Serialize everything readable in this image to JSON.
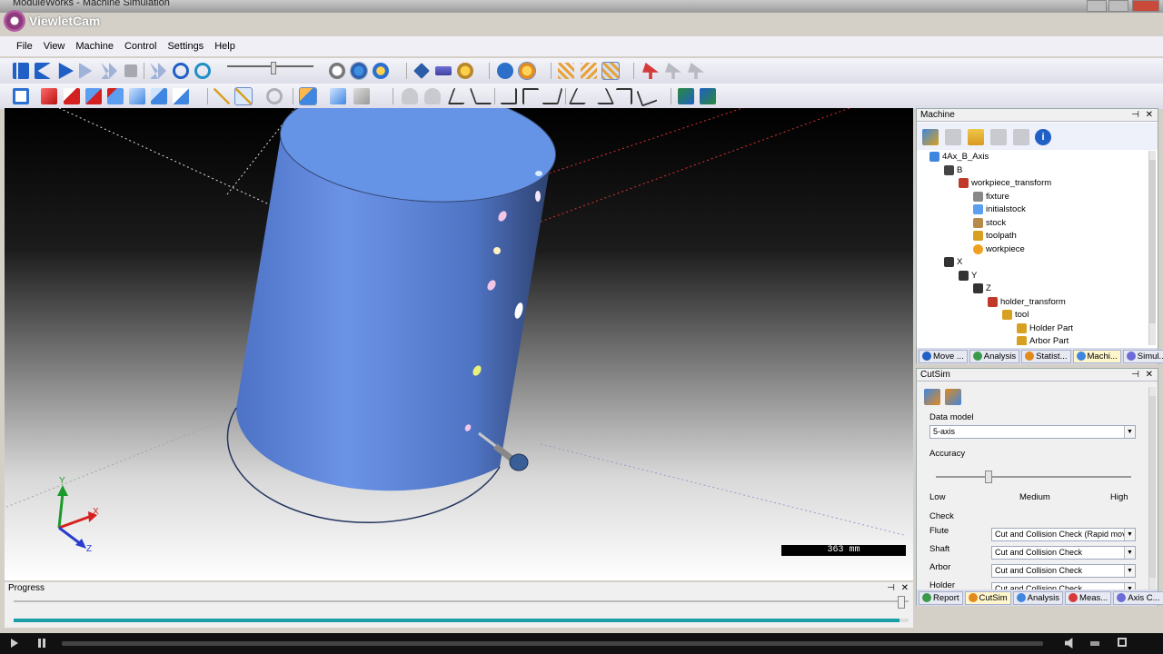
{
  "window": {
    "title": "ModuleWorks - Machine Simulation"
  },
  "watermark": {
    "text": "ViewletCam"
  },
  "menu": [
    "File",
    "View",
    "Machine",
    "Control",
    "Settings",
    "Help"
  ],
  "viewport": {
    "axes": {
      "x": "X",
      "y": "Y",
      "z": "Z"
    },
    "scale_text": "363 mm"
  },
  "progress": {
    "title": "Progress",
    "value": 0.99
  },
  "machine_panel": {
    "title": "Machine",
    "tree": [
      {
        "label": "4Ax_B_Axis",
        "icon": "machine-icon"
      },
      {
        "label": "B",
        "icon": "rotary-axis-icon"
      },
      {
        "label": "workpiece_transform",
        "icon": "transform-icon"
      },
      {
        "label": "fixture",
        "icon": "fixture-icon"
      },
      {
        "label": "initialstock",
        "icon": "stock-cube-icon"
      },
      {
        "label": "stock",
        "icon": "stock-icon"
      },
      {
        "label": "toolpath",
        "icon": "toolpath-icon"
      },
      {
        "label": "workpiece",
        "icon": "workpiece-icon"
      },
      {
        "label": "X",
        "icon": "linear-axis-icon"
      },
      {
        "label": "Y",
        "icon": "linear-axis-icon"
      },
      {
        "label": "Z",
        "icon": "linear-axis-icon"
      },
      {
        "label": "holder_transform",
        "icon": "transform-icon"
      },
      {
        "label": "tool",
        "icon": "tool-icon"
      },
      {
        "label": "Holder Part",
        "icon": "tool-part-icon"
      },
      {
        "label": "Arbor Part",
        "icon": "tool-part-icon"
      }
    ],
    "tabs": [
      "Move ...",
      "Analysis",
      "Statist...",
      "Machi...",
      "Simul..."
    ]
  },
  "cutsim_panel": {
    "title": "CutSim",
    "data_model_label": "Data model",
    "data_model_value": "5-axis",
    "accuracy_label": "Accuracy",
    "accuracy_low": "Low",
    "accuracy_medium": "Medium",
    "accuracy_high": "High",
    "accuracy_value": 0.27,
    "check_label": "Check",
    "checks": [
      {
        "label": "Flute",
        "value": "Cut and Collision Check (Rapid moves"
      },
      {
        "label": "Shaft",
        "value": "Cut and Collision Check"
      },
      {
        "label": "Arbor",
        "value": "Cut and Collision Check"
      },
      {
        "label": "Holder",
        "value": "Cut and Collision Check"
      }
    ],
    "tabs": [
      "Report",
      "CutSim",
      "Analysis",
      "Meas...",
      "Axis C..."
    ]
  }
}
